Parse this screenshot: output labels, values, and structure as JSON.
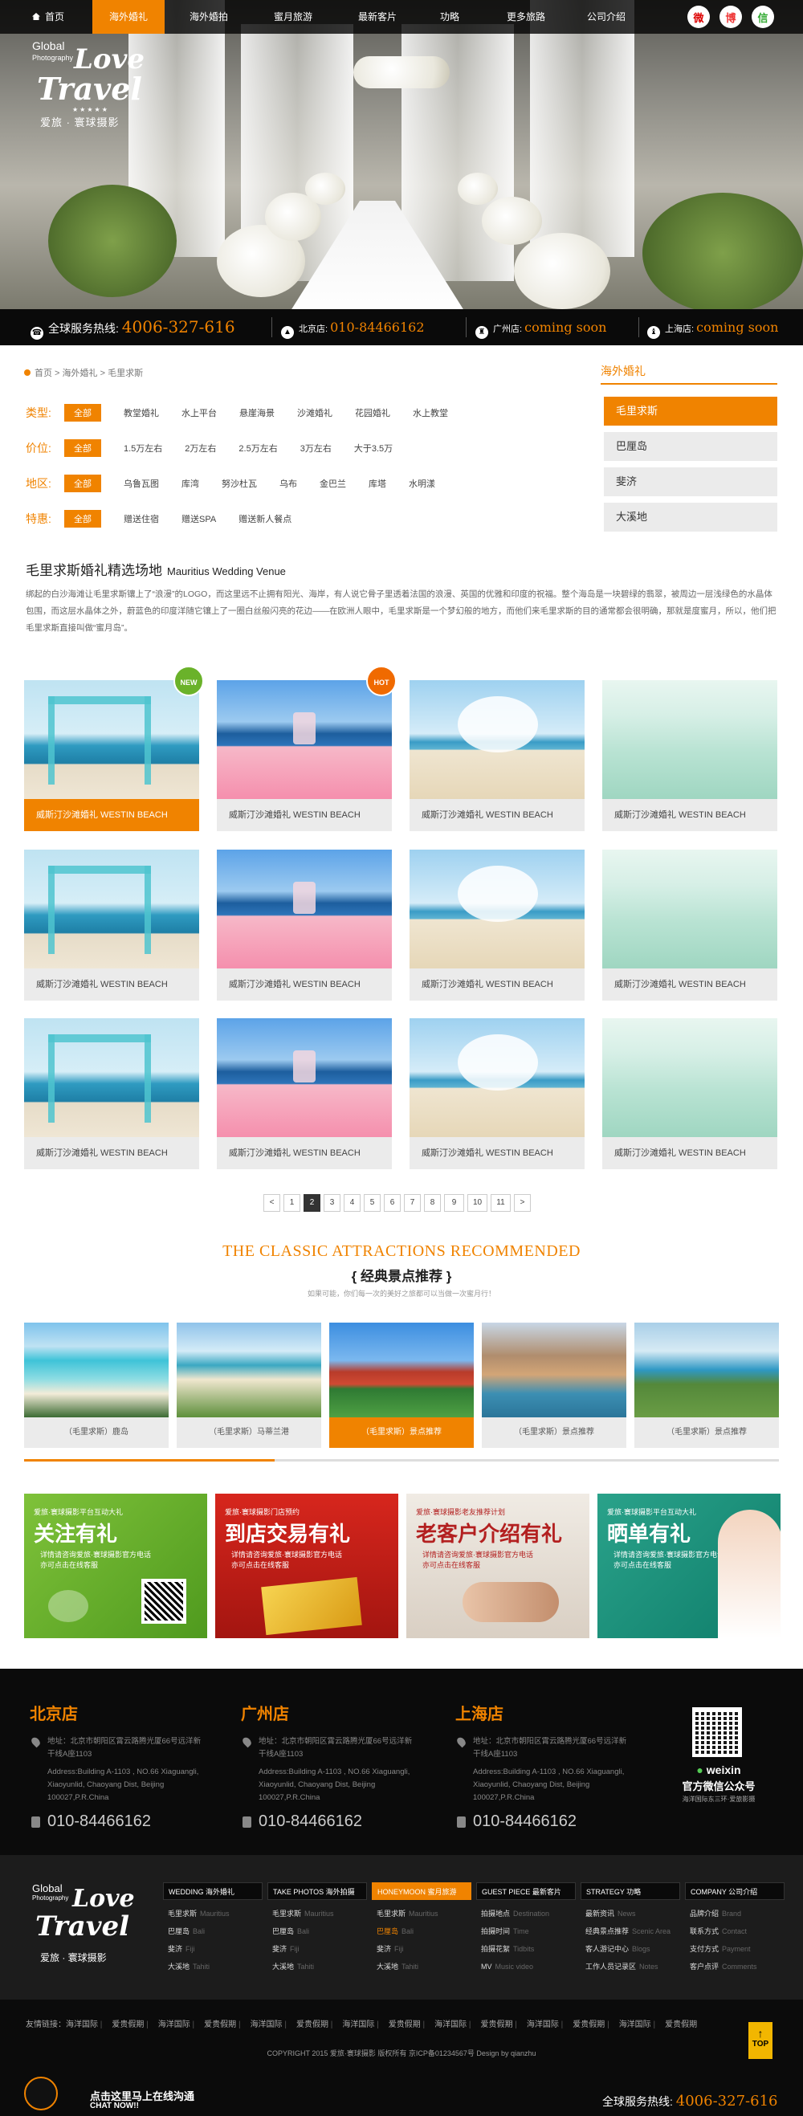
{
  "nav": {
    "home": "首页",
    "items": [
      "海外婚礼",
      "海外婚拍",
      "蜜月旅游",
      "最新客片",
      "功略",
      "更多旅路",
      "公司介绍"
    ],
    "active_index": 0
  },
  "social": [
    "微",
    "博",
    "信"
  ],
  "logo": {
    "global": "Global",
    "photography": "Photography",
    "love": "Love",
    "travel": "Travel",
    "cn": "爱旅 · 寰球摄影"
  },
  "hotline": {
    "label": "全球服务热线:",
    "number": "4006-327-616",
    "beijing_label": "北京店:",
    "beijing": "010-84466162",
    "guangzhou_label": "广州店:",
    "guangzhou": "coming soon",
    "shanghai_label": "上海店:",
    "shanghai": "coming soon"
  },
  "breadcrumb": [
    "首页",
    "海外婚礼",
    "毛里求斯"
  ],
  "filters": [
    {
      "label": "类型:",
      "all": "全部",
      "options": [
        "教堂婚礼",
        "水上平台",
        "悬崖海景",
        "沙滩婚礼",
        "花园婚礼",
        "水上教堂"
      ]
    },
    {
      "label": "价位:",
      "all": "全部",
      "options": [
        "1.5万左右",
        "2万左右",
        "2.5万左右",
        "3万左右",
        "大于3.5万"
      ]
    },
    {
      "label": "地区:",
      "all": "全部",
      "options": [
        "乌鲁瓦图",
        "库湾",
        "努沙杜瓦",
        "乌布",
        "金巴兰",
        "库塔",
        "水明漾"
      ]
    },
    {
      "label": "特惠:",
      "all": "全部",
      "options": [
        "赠送住宿",
        "赠送SPA",
        "赠送新人餐点"
      ]
    }
  ],
  "side": {
    "title": "海外婚礼",
    "items": [
      "毛里求斯",
      "巴厘岛",
      "斐济",
      "大溪地"
    ],
    "active_index": 0
  },
  "venue": {
    "title": "毛里求斯婚礼精选场地",
    "title_en": "Mauritius Wedding Venue",
    "desc": "绑起的白沙海滩让毛里求斯镶上了“浪漫”的LOGO，而这里远不止拥有阳光、海岸，有人说它骨子里透着法国的浪漫、英国的优雅和印度的祝福。整个海岛是一块碧绿的翡翠，被周边一层浅绿色的水晶体包围，而这层水晶体之外，蔚蓝色的印度洋随它镶上了一圈白丝般闪亮的花边——在欧洲人眼中，毛里求斯是一个梦幻般的地方，而他们来毛里求斯的目的通常都会很明确，那就是度蜜月，所以，他们把毛里求斯直接叫做“蜜月岛”。"
  },
  "grid": {
    "caption": "威斯汀沙滩婚礼  WESTIN BEACH",
    "badges": {
      "new": "NEW",
      "hot": "HOT"
    },
    "active_index": 0
  },
  "pager": {
    "prev": "<",
    "pages": [
      "1",
      "2",
      "3",
      "4",
      "5",
      "6",
      "7",
      "8",
      "9",
      "10",
      "11"
    ],
    "next": ">",
    "current": "2"
  },
  "classic": {
    "en": "THE CLASSIC ATTRACTIONS RECOMMENDED",
    "cn": "{  经典景点推荐  }",
    "sub": "如果可能，你们每一次的美好之旅都可以当做一次蜜月行！",
    "items": [
      "（毛里求斯）鹿岛",
      "（毛里求斯）马蒂兰港",
      "（毛里求斯）景点推荐",
      "（毛里求斯）景点推荐",
      "（毛里求斯）景点推荐"
    ],
    "active_index": 2
  },
  "promos": [
    {
      "top": "爱旅·寰球摄影平台互动大礼",
      "big": "关注有礼",
      "small": "详情请咨询爱旅·寰球摄影官方电话\n亦可点击在线客服"
    },
    {
      "top": "爱旅·寰球摄影门店预约",
      "big": "到店交易有礼",
      "small": "详情请咨询爱旅·寰球摄影官方电话\n亦可点击在线客服"
    },
    {
      "top": "爱旅·寰球摄影老友推荐计划",
      "big": "老客户介绍有礼",
      "small": "详情请咨询爱旅·寰球摄影官方电话\n亦可点击在线客服"
    },
    {
      "top": "爱旅·寰球摄影平台互动大礼",
      "big": "晒单有礼",
      "small": "详情请咨询爱旅·寰球摄影官方电话\n亦可点击在线客服"
    }
  ],
  "stores": [
    {
      "name": "北京店",
      "addr1": "地址：北京市朝阳区霄云路腾光厦66号远洋新干线A座1103",
      "addr2": "Address:Building A-1103 , NO.66 Xiaguangli, Xiaoyunlid, Chaoyang Dist, Beijing 100027,P.R.China",
      "tel": "010-84466162"
    },
    {
      "name": "广州店",
      "addr1": "地址：北京市朝阳区霄云路腾光厦66号远洋新干线A座1103",
      "addr2": "Address:Building A-1103 , NO.66 Xiaguangli, Xiaoyunlid, Chaoyang Dist, Beijing 100027,P.R.China",
      "tel": "010-84466162"
    },
    {
      "name": "上海店",
      "addr1": "地址：北京市朝阳区霄云路腾光厦66号远洋新干线A座1103",
      "addr2": "Address:Building A-1103 , NO.66 Xiaguangli, Xiaoyunlid, Chaoyang Dist, Beijing 100027,P.R.China",
      "tel": "010-84466162"
    }
  ],
  "wechat": {
    "title": "weixin",
    "sub": "官方微信公众号",
    "small": "海洋国际东三环·爱旅影摄"
  },
  "footer_menu": [
    {
      "head": "WEDDING 海外婚礼",
      "links": [
        [
          "毛里求斯",
          "Mauritius"
        ],
        [
          "巴厘岛",
          "Bali"
        ],
        [
          "斐济",
          "Fiji"
        ],
        [
          "大溪地",
          "Tahiti"
        ]
      ]
    },
    {
      "head": "TAKE PHOTOS 海外拍摄",
      "links": [
        [
          "毛里求斯",
          "Mauritius"
        ],
        [
          "巴厘岛",
          "Bali"
        ],
        [
          "斐济",
          "Fiji"
        ],
        [
          "大溪地",
          "Tahiti"
        ]
      ]
    },
    {
      "head": "HONEYMOON 蜜月旅游",
      "links": [
        [
          "毛里求斯",
          "Mauritius"
        ],
        [
          "巴厘岛",
          "Bali"
        ],
        [
          "斐济",
          "Fiji"
        ],
        [
          "大溪地",
          "Tahiti"
        ]
      ]
    },
    {
      "head": "GUEST PIECE 最新客片",
      "links": [
        [
          "拍摄地点",
          "Destination"
        ],
        [
          "拍摄时间",
          "Time"
        ],
        [
          "拍摄花絮",
          "Tidbits"
        ],
        [
          "MV",
          "Music video"
        ]
      ]
    },
    {
      "head": "STRATEGY 功略",
      "links": [
        [
          "最新资讯",
          "News"
        ],
        [
          "经典景点推荐",
          "Scenic Area"
        ],
        [
          "客人游记中心",
          "Blogs"
        ],
        [
          "工作人员记录区",
          "Notes"
        ]
      ]
    },
    {
      "head": "COMPANY 公司介绍",
      "links": [
        [
          "品牌介绍",
          "Brand"
        ],
        [
          "联系方式",
          "Contact"
        ],
        [
          "支付方式",
          "Payment"
        ],
        [
          "客户点评",
          "Comments"
        ]
      ]
    }
  ],
  "footer_menu_active": 2,
  "links_label": "友情链接：",
  "friend_links": [
    "海洋国际",
    "爱贵假期",
    "海洋国际",
    "爱贵假期",
    "海洋国际",
    "爱贵假期",
    "海洋国际",
    "爱贵假期",
    "海洋国际",
    "爱贵假期",
    "海洋国际",
    "爱贵假期",
    "海洋国际",
    "爱贵假期"
  ],
  "copyright": "COPYRIGHT 2015 爱旅·寰球摄影 版权所有  京ICP备01234567号  Design by qianzhu",
  "top_button": "TOP",
  "chat": {
    "t1": "点击这里马上在线沟通",
    "t2": "CHAT NOW!!"
  },
  "bottom_hotline": {
    "label": "全球服务热线:",
    "number": "4006-327-616"
  },
  "colors": {
    "accent": "#f08300",
    "dark": "#0b0b0b"
  }
}
